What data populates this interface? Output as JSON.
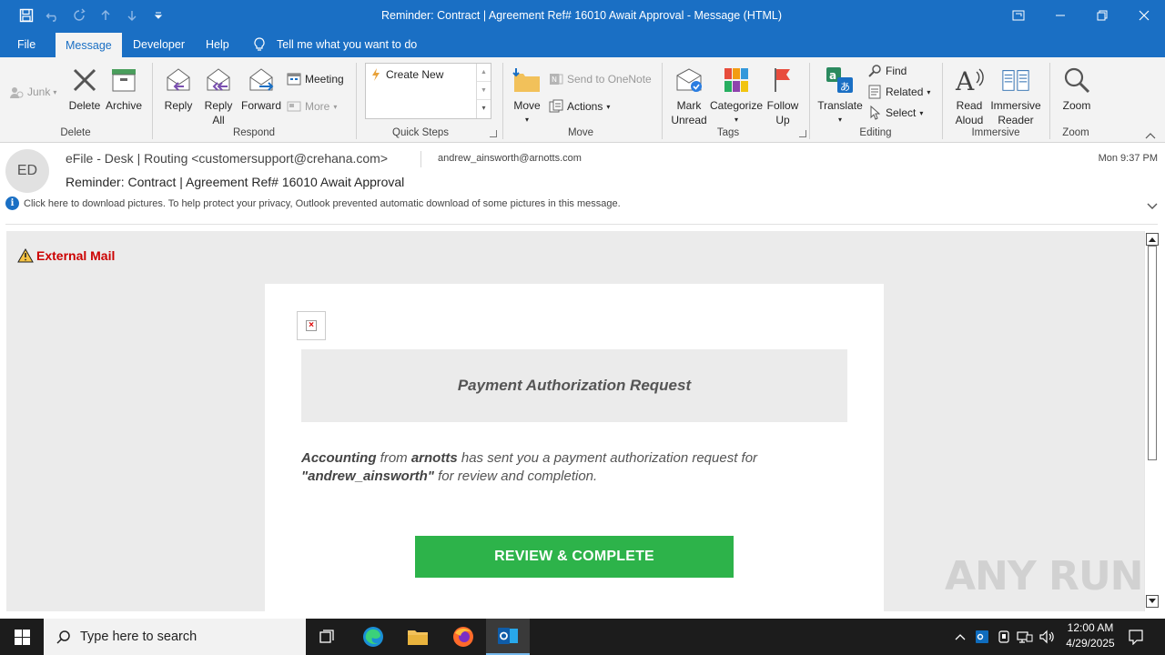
{
  "window": {
    "title": "Reminder:  Contract | Agreement Ref# 16010 Await Approval  -  Message (HTML)"
  },
  "menu_tabs": [
    {
      "label": "File"
    },
    {
      "label": "Message"
    },
    {
      "label": "Developer"
    },
    {
      "label": "Help"
    },
    {
      "label": "Tell me what you want to do"
    }
  ],
  "ribbon": {
    "delete_group": {
      "label": "Delete",
      "junk": "Junk",
      "delete": "Delete",
      "archive": "Archive"
    },
    "respond_group": {
      "label": "Respond",
      "reply": "Reply",
      "reply_all_1": "Reply",
      "reply_all_2": "All",
      "forward": "Forward",
      "meeting": "Meeting",
      "more": "More"
    },
    "quick_steps_group": {
      "label": "Quick Steps",
      "create_new": "Create New"
    },
    "move_group": {
      "label": "Move",
      "move": "Move",
      "onenote": "Send to OneNote",
      "actions": "Actions"
    },
    "tags_group": {
      "label": "Tags",
      "mark_unread_1": "Mark",
      "mark_unread_2": "Unread",
      "categorize": "Categorize",
      "follow_up_1": "Follow",
      "follow_up_2": "Up"
    },
    "editing_group": {
      "label": "Editing",
      "translate": "Translate",
      "find": "Find",
      "related": "Related",
      "select": "Select"
    },
    "immersive_group": {
      "label": "Immersive",
      "read_aloud_1": "Read",
      "read_aloud_2": "Aloud",
      "immersive_reader_1": "Immersive",
      "immersive_reader_2": "Reader"
    },
    "zoom_group": {
      "label": "Zoom",
      "zoom": "Zoom"
    }
  },
  "message": {
    "avatar_initials": "ED",
    "sender": "eFile - Desk | Routing <customersupport@crehana.com>",
    "recipient": "andrew_ainsworth@arnotts.com",
    "datetime": "Mon 9:37 PM",
    "subject": "Reminder:  Contract | Agreement Ref# 16010 Await Approval",
    "info_bar": "Click here to download pictures. To help protect your privacy, Outlook prevented automatic download of some pictures in this message."
  },
  "body": {
    "external_label": "External Mail",
    "banner_title": "Payment Authorization Request",
    "text_sender": "Accounting",
    "text_from": " from ",
    "text_company": "arnotts",
    "text_middle": " has sent you a payment authorization request for ",
    "text_recipient": "\"andrew_ainsworth\"",
    "text_end": " for review and completion.",
    "cta_label": "REVIEW & COMPLETE"
  },
  "watermark": "ANY RUN",
  "taskbar": {
    "search_placeholder": "Type here to search",
    "time": "12:00 AM",
    "date": "4/29/2025"
  },
  "colors": {
    "title_blue": "#1a6fc4",
    "external_red": "#cc0000",
    "cta_green": "#2db34a"
  }
}
